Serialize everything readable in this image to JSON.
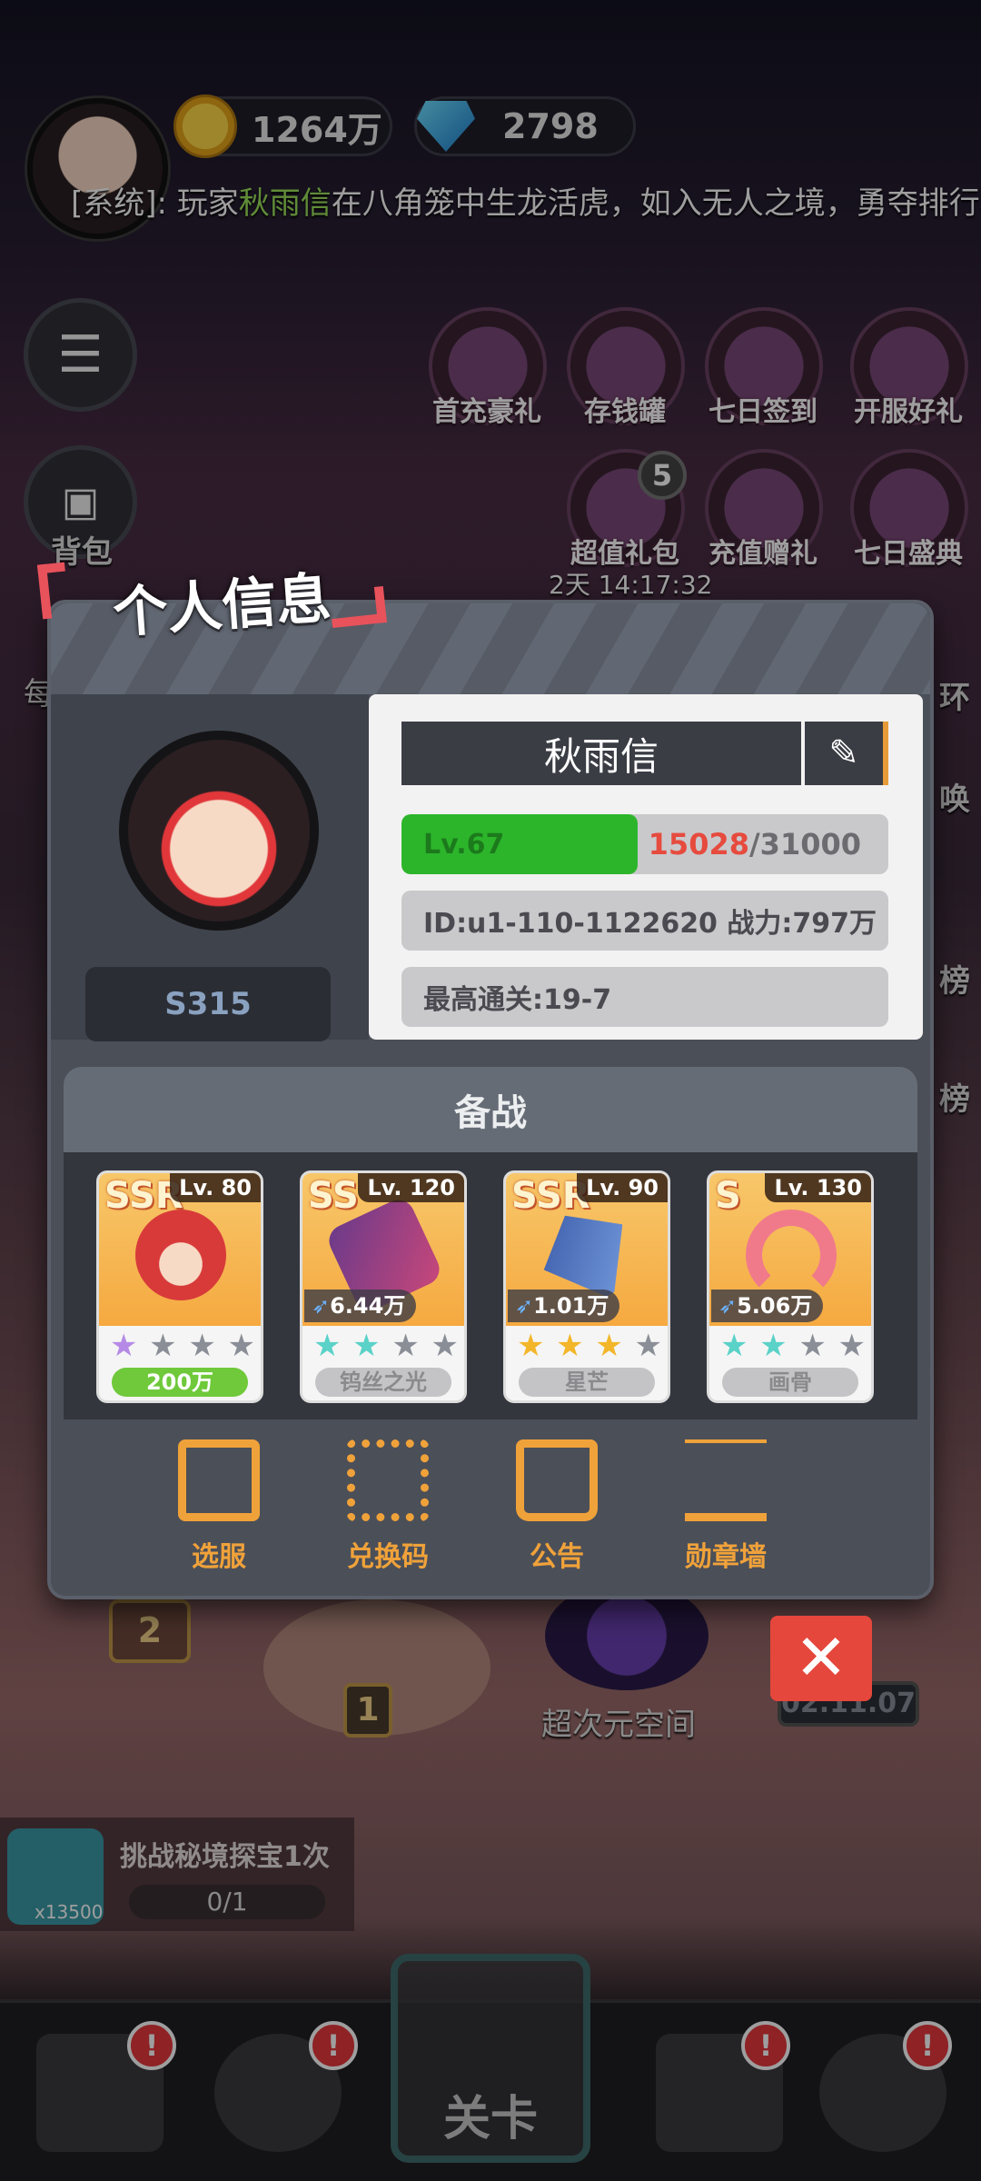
{
  "top": {
    "coins": "1264万",
    "gems": "2798",
    "ticker": {
      "prefix": "[系统]: 玩家",
      "player": "秋雨信",
      "suffix": "在八角笼中生龙活虎，如入无人之境，勇夺排行榜"
    }
  },
  "side": {
    "bag_label": "背包",
    "partial_left": "每"
  },
  "events": [
    {
      "label": "首充豪礼"
    },
    {
      "label": "存钱罐"
    },
    {
      "label": "七日签到"
    },
    {
      "label": "开服好礼"
    },
    {
      "label": "超值礼包",
      "badge": "5"
    },
    {
      "label": "充值赠礼"
    },
    {
      "label": "七日盛典"
    }
  ],
  "timer": "2天 14:17:32",
  "right_partial": [
    "环",
    "唤",
    "榜",
    "榜"
  ],
  "modal": {
    "title": "个人信息",
    "server": "S315",
    "name": "秋雨信",
    "edit_icon": "pencil-icon",
    "level_label": "Lv.67",
    "xp_current": "15028",
    "xp_total": "/31000",
    "xp_fraction": 0.485,
    "id_line": "ID:u1-110-1122620  战力:797万",
    "best_stage": "最高通关:19-7",
    "prep_title": "备战",
    "cards": [
      {
        "rarity": "SSR",
        "level": "Lv. 80",
        "power": "",
        "stars": [
          "purple",
          "gray",
          "gray",
          "gray"
        ],
        "name": "200万",
        "name_green": true
      },
      {
        "rarity": "SS",
        "level": "Lv. 120",
        "power": "6.44万",
        "stars": [
          "teal",
          "teal",
          "gray",
          "gray"
        ],
        "name": "钨丝之光",
        "name_green": false
      },
      {
        "rarity": "SSR",
        "level": "Lv. 90",
        "power": "1.01万",
        "stars": [
          "gold",
          "gold",
          "gold",
          "gray"
        ],
        "name": "星芒",
        "name_green": false
      },
      {
        "rarity": "S",
        "level": "Lv. 130",
        "power": "5.06万",
        "stars": [
          "teal",
          "teal",
          "gray",
          "gray"
        ],
        "name": "画骨",
        "name_green": false
      }
    ],
    "actions": [
      {
        "label": "选服",
        "icon": "resize-icon"
      },
      {
        "label": "兑换码",
        "icon": "qr-code-icon"
      },
      {
        "label": "公告",
        "icon": "clipboard-icon"
      },
      {
        "label": "勋章墙",
        "icon": "medal-stand-icon"
      }
    ]
  },
  "background": {
    "portal_label": "超次元空间",
    "stage_1": "1",
    "stage_2": "2",
    "date_badge": "02.11.07"
  },
  "quest": {
    "title": "挑战秘境探宝1次",
    "progress": "0/1",
    "reward_count": "x13500"
  },
  "bottom": {
    "center_tab": "关卡",
    "alert": "!"
  },
  "colors": {
    "accent": "#f0a23a",
    "level_green": "#2cb52b",
    "xp_red": "#e64b3e",
    "title_bracket": "#e8525b"
  }
}
